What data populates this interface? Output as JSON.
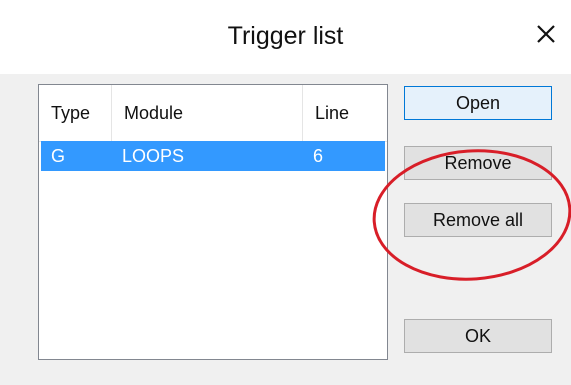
{
  "window": {
    "title": "Trigger list",
    "close_glyph": "✕"
  },
  "list": {
    "columns": [
      "Type",
      "Module",
      "Line"
    ],
    "rows": [
      {
        "type": "G",
        "module": "LOOPS",
        "line": "6",
        "selected": true
      }
    ],
    "selection_color": "#3399ff"
  },
  "buttons": {
    "open": "Open",
    "remove": "Remove",
    "remove_all": "Remove all",
    "ok": "OK"
  },
  "annotation": {
    "shape": "ellipse",
    "color": "#d81e28",
    "highlights": [
      "Remove",
      "Remove all"
    ]
  }
}
